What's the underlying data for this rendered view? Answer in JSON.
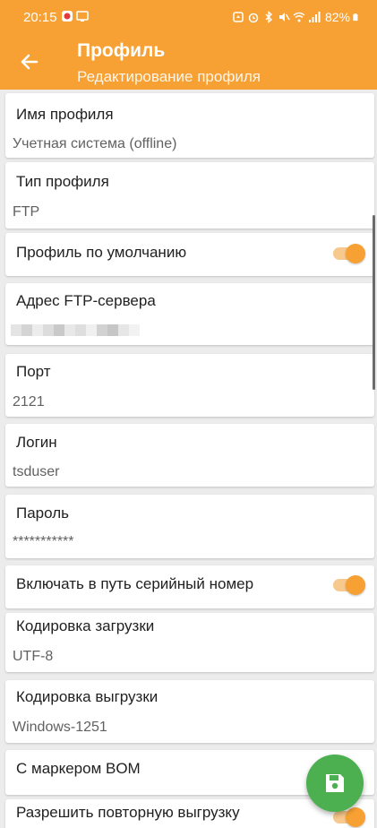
{
  "status_bar": {
    "time": "20:15",
    "battery": "82%",
    "left_icons": [
      "app-notification-icon",
      "screen-mirror-icon"
    ],
    "right_icons": [
      "cloud-icon",
      "alarm-icon",
      "bluetooth-icon",
      "mute-icon",
      "wifi-icon",
      "signal-icon",
      "battery-icon"
    ]
  },
  "app_bar": {
    "title": "Профиль",
    "subtitle": "Редактирование профиля",
    "back_icon": "arrow-back-icon"
  },
  "settings": {
    "profile_name": {
      "label": "Имя профиля",
      "value": "Учетная система (offline)"
    },
    "profile_type": {
      "label": "Тип профиля",
      "value": "FTP"
    },
    "default_profile": {
      "label": "Профиль по умолчанию",
      "enabled": true
    },
    "ftp_address": {
      "label": "Адрес FTP-сервера"
    },
    "port": {
      "label": "Порт",
      "value": "2121"
    },
    "login": {
      "label": "Логин",
      "value": "tsduser"
    },
    "password": {
      "label": "Пароль",
      "value": "***********"
    },
    "serial_in_path": {
      "label": "Включать в путь серийный номер",
      "enabled": true
    },
    "upload_encoding": {
      "label": "Кодировка загрузки",
      "value": "UTF-8"
    },
    "download_encoding": {
      "label": "Кодировка выгрузки",
      "value": "Windows-1251"
    },
    "bom_marker": {
      "label": "С маркером BOM"
    },
    "allow_reupload": {
      "label": "Разрешить повторную выгрузку",
      "enabled": true
    }
  },
  "fab": {
    "icon": "save-icon"
  },
  "colors": {
    "accent": "#f7a033",
    "accent_light": "#f8c98e",
    "fab": "#4caf50",
    "background": "#ececec",
    "card": "#ffffff"
  }
}
